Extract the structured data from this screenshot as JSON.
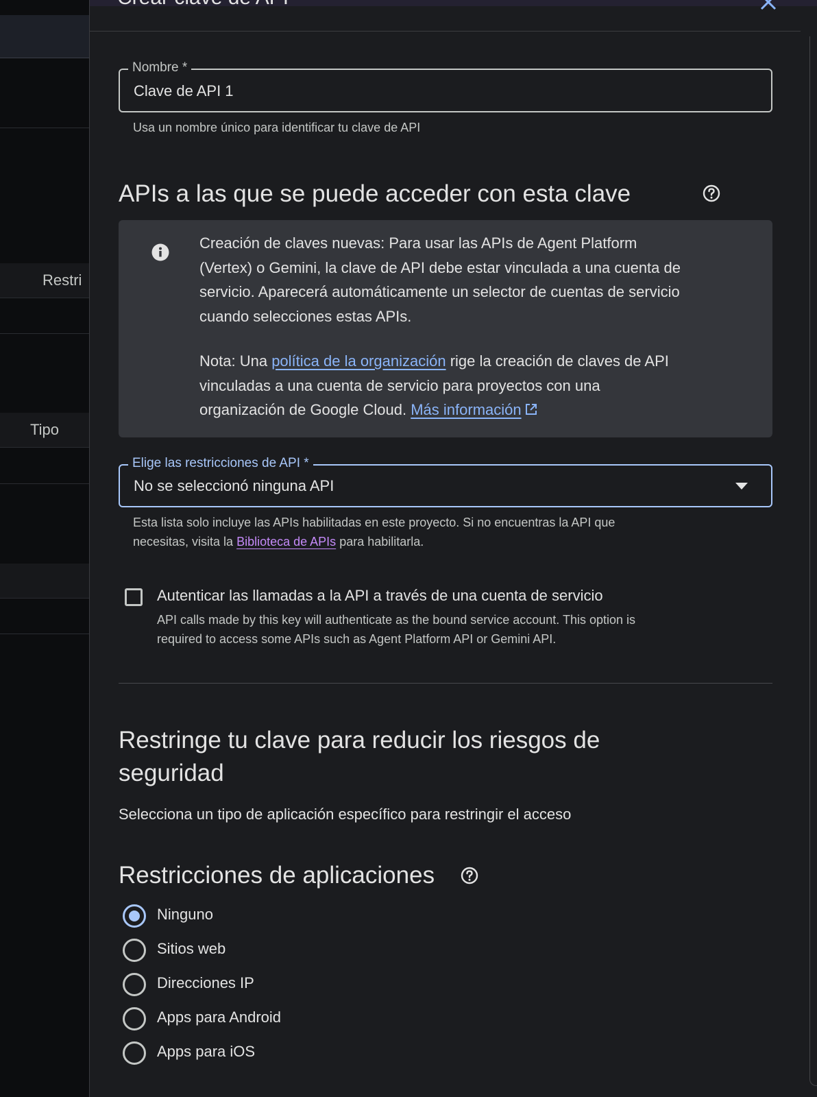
{
  "background_page": {
    "col_restrictions": "Restri",
    "col_type": "Tipo"
  },
  "dialog": {
    "title": "Crear clave de API",
    "close_icon": "close-icon",
    "name_field": {
      "label": "Nombre *",
      "value": "Clave de API 1",
      "helper": "Usa un nombre único para identificar tu clave de API"
    },
    "apis_section": {
      "heading": "APIs a las que se puede acceder con esta clave",
      "help_icon": "help-circle-icon",
      "info": {
        "icon": "info-icon",
        "para1_line1": "Creación de claves nuevas: Para usar las APIs de Agent Platform",
        "para1_line2": "(Vertex) o Gemini, la clave de API debe estar vinculada a una cuenta de",
        "para1_line3": "servicio. Aparecerá automáticamente un selector de cuentas de servicio",
        "para1_line4": "cuando selecciones estas APIs.",
        "para2_prefix": "Nota: Una",
        "para2_link": "política de la organización",
        "para2_after_link": "rige la creación de claves de API",
        "para2_line2": "vinculadas a una cuenta de servicio para proyectos con una",
        "para2_line3": "organización de Google Cloud.",
        "more_info_link": "Más información",
        "external_icon": "open-in-new-icon"
      },
      "restrictions_select": {
        "label": "Elige las restricciones de API *",
        "value": "No se seleccionó ninguna API"
      },
      "select_helper_line1": "Esta lista solo incluye las APIs habilitadas en este proyecto. Si no encuentras la API que",
      "select_helper_prefix": "necesitas, visita la",
      "select_helper_link": "Biblioteca de APIs",
      "select_helper_suffix": "para habilitarla.",
      "auth_checkbox": {
        "checked": false,
        "label": "Autenticar las llamadas a la API a través de una cuenta de servicio",
        "desc_line1": "API calls made by this key will authenticate as the bound service account. This option is",
        "desc_line2": "required to access some APIs such as Agent Platform API or Gemini API."
      }
    },
    "restrict_section": {
      "heading_line1": "Restringe tu clave para reducir los riesgos de",
      "heading_line2": "seguridad",
      "subtitle": "Selecciona un tipo de aplicación específico para restringir el acceso"
    },
    "app_restrictions": {
      "heading": "Restricciones de aplicaciones",
      "options": [
        "Ninguno",
        "Sitios web",
        "Direcciones IP",
        "Apps para Android",
        "Apps para iOS"
      ],
      "selected": "Ninguno"
    }
  },
  "colors": {
    "panel_bg": "#1b1c1f",
    "accent": "#a8c7fa",
    "link": "#8ab4f8",
    "visited_link": "#c58af9",
    "info_bg": "#34363b"
  }
}
